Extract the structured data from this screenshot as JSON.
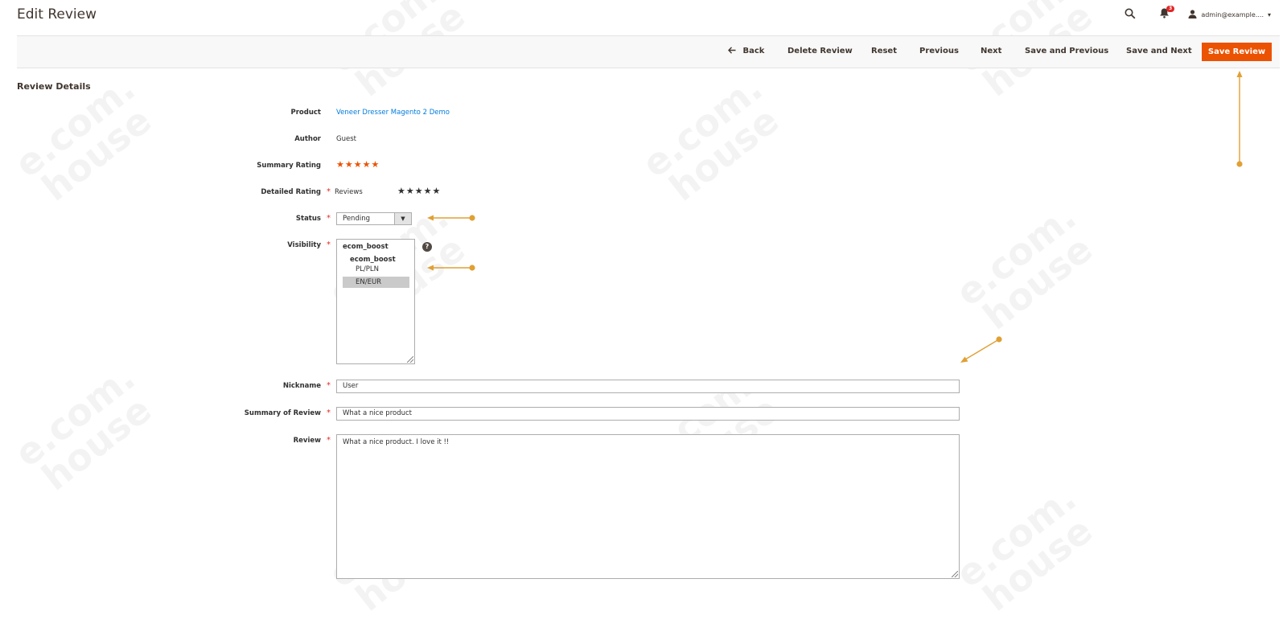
{
  "header": {
    "title": "Edit Review",
    "notifications_count": "3",
    "user_label": "admin@example....",
    "icons": [
      "search-icon",
      "bell-icon",
      "user-icon",
      "caret-down-icon"
    ]
  },
  "actions": {
    "back": "Back",
    "delete": "Delete Review",
    "reset": "Reset",
    "previous": "Previous",
    "next": "Next",
    "save_previous": "Save and Previous",
    "save_next": "Save and Next",
    "save": "Save Review"
  },
  "section": {
    "title": "Review Details"
  },
  "form": {
    "product": {
      "label": "Product",
      "value": "Veneer Dresser Magento 2 Demo"
    },
    "author": {
      "label": "Author",
      "value": "Guest"
    },
    "summary_rating": {
      "label": "Summary Rating",
      "stars": "★★★★★",
      "value": 5
    },
    "detailed_rating": {
      "label": "Detailed Rating",
      "name": "Reviews",
      "stars": "★★★★★"
    },
    "status": {
      "label": "Status",
      "value": "Pending"
    },
    "visibility": {
      "label": "Visibility",
      "options": [
        "ecom_boost",
        "ecom_boost",
        "PL/PLN",
        "EN/EUR"
      ],
      "selected": "EN/EUR",
      "help": "?"
    },
    "nickname": {
      "label": "Nickname",
      "value": "User"
    },
    "summary": {
      "label": "Summary of Review",
      "value": "What a nice product"
    },
    "review": {
      "label": "Review",
      "value": "What a nice product. I love it !!"
    },
    "required_mark": "*"
  },
  "watermark": {
    "line1": "e.com.",
    "line2": "house"
  },
  "colors": {
    "accent": "#eb5202",
    "link": "#007bdb",
    "annotation": "#e0a034",
    "required": "#e02b27"
  }
}
